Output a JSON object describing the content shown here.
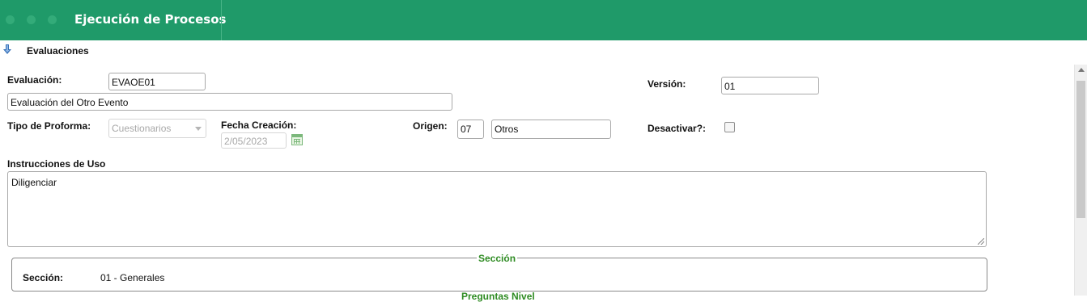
{
  "header": {
    "title": "Ejecución de Procesos"
  },
  "panel": {
    "title": "Evaluaciones"
  },
  "form": {
    "evaluacion_label": "Evaluación:",
    "evaluacion_code": "EVAOE01",
    "evaluacion_name": "Evaluación del Otro Evento",
    "version_label": "Versión:",
    "version_value": "01",
    "tipo_proforma_label": "Tipo de Proforma:",
    "tipo_proforma_value": "Cuestionarios",
    "fecha_label": "Fecha Creación:",
    "fecha_value": "2/05/2023",
    "origen_label": "Origen:",
    "origen_code": "07",
    "origen_name": "Otros",
    "desactivar_label": "Desactivar?:",
    "desactivar_checked": false,
    "instrucciones_label": "Instrucciones de Uso",
    "instrucciones_value": "Diligenciar"
  },
  "seccion": {
    "legend": "Sección",
    "label": "Sección:",
    "value": "01 - Generales",
    "next_legend": "Preguntas Nivel"
  }
}
